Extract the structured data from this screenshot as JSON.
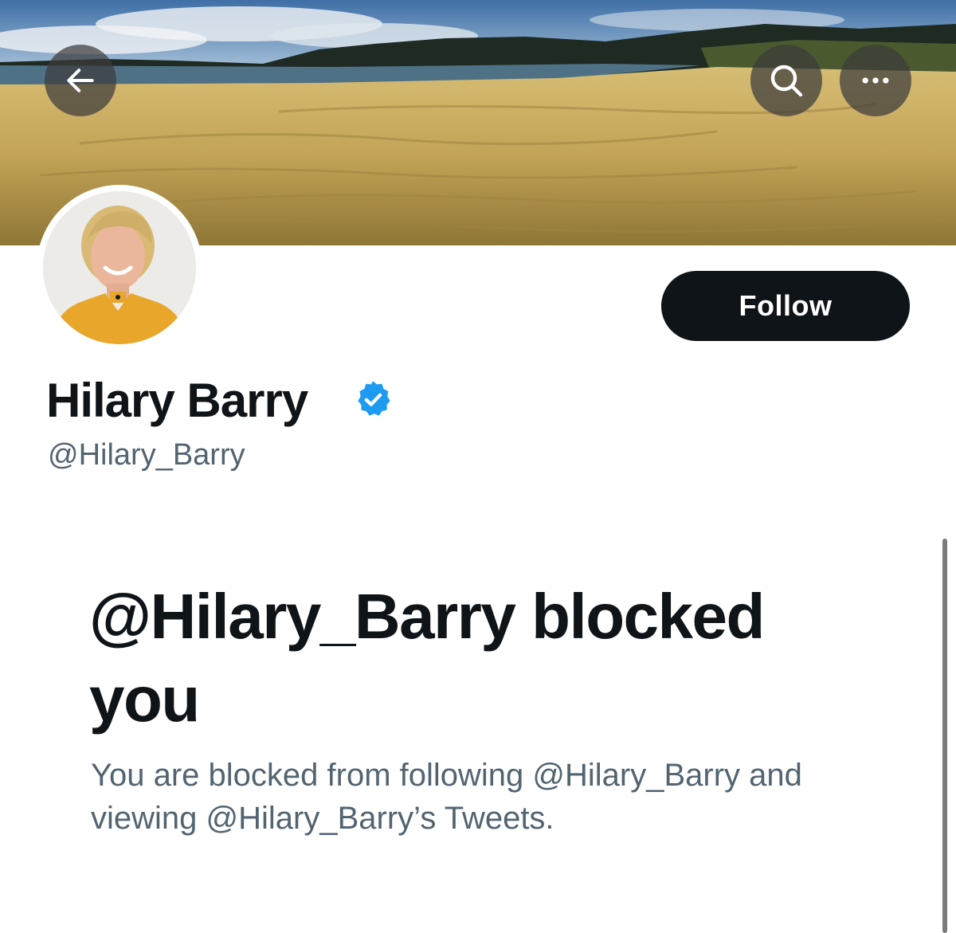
{
  "header": {
    "back_icon": "arrow-left-icon",
    "search_icon": "search-icon",
    "more_icon": "more-horizontal-icon"
  },
  "profile": {
    "display_name": "Hilary Barry",
    "verified_icon": "verified-badge-icon",
    "handle": "@Hilary_Barry",
    "follow_label": "Follow"
  },
  "blocked": {
    "title": "@Hilary_Barry blocked you",
    "message": "You are blocked from following @Hilary_Barry and viewing @Hilary_Barry’s Tweets."
  },
  "colors": {
    "button_bg": "#0f1419",
    "secondary_text": "#536471",
    "verified_blue": "#1d9bf0"
  }
}
